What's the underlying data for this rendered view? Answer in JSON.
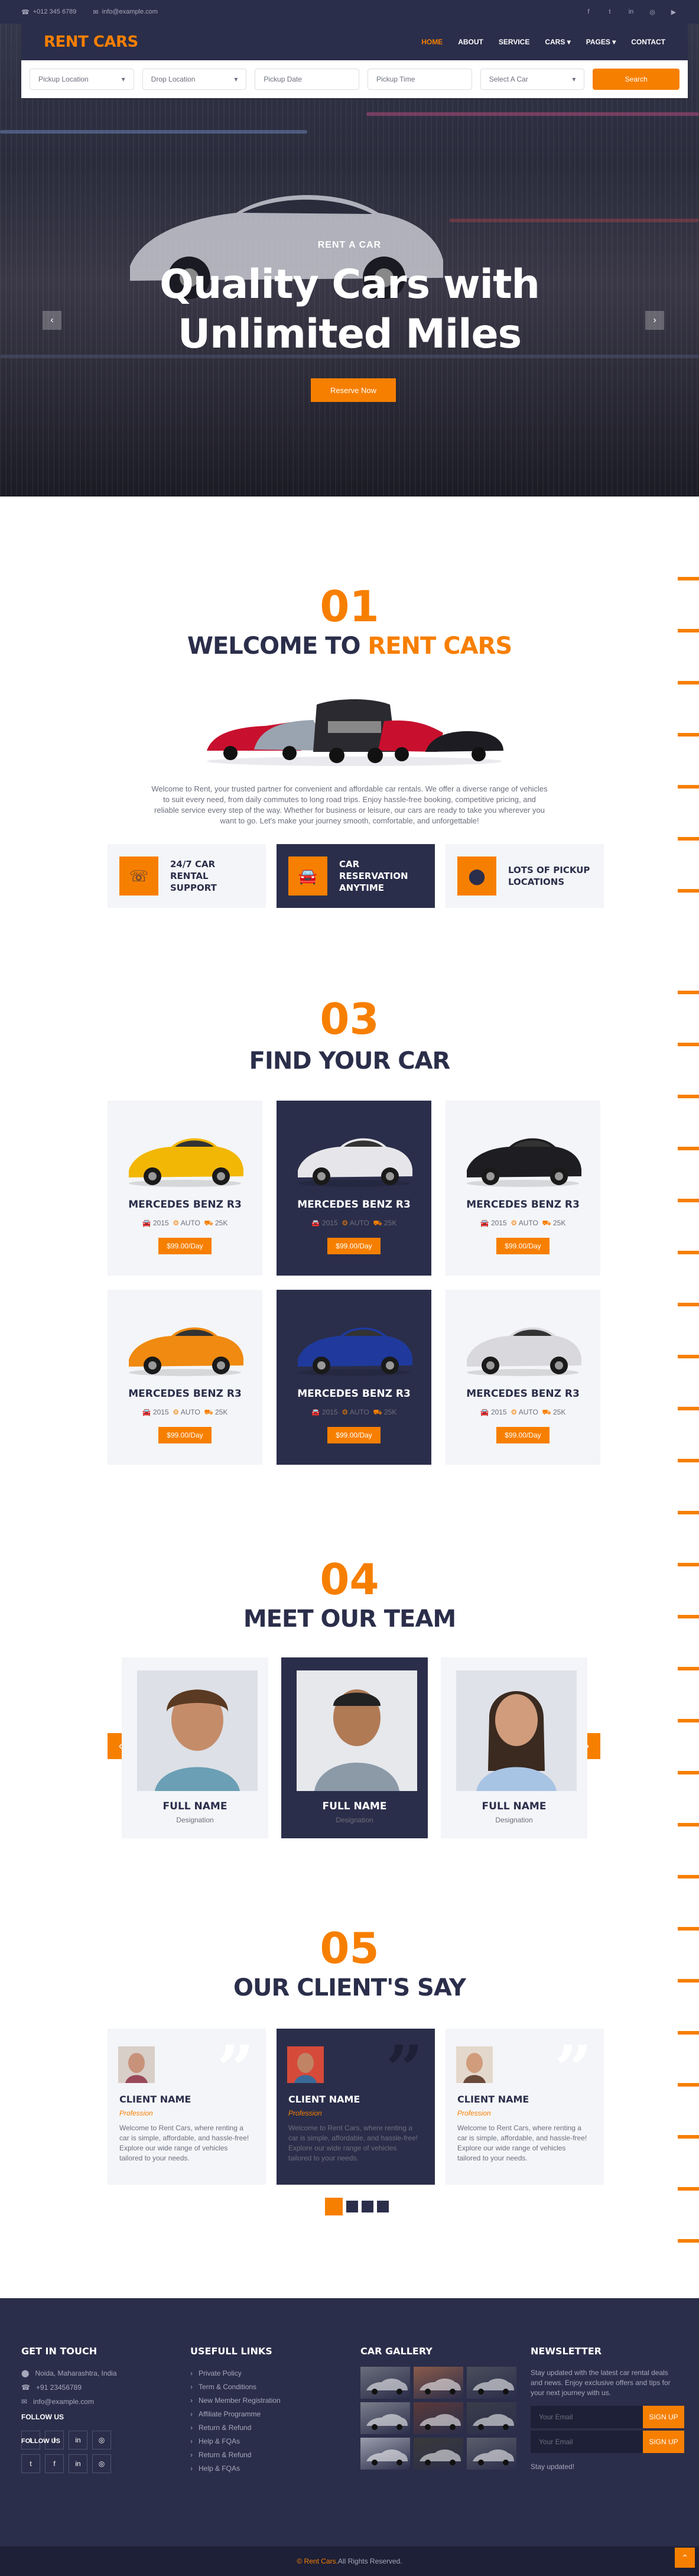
{
  "topbar": {
    "phone": "+012 345 6789",
    "email": "info@example.com"
  },
  "nav": {
    "logo": "RENT CARS",
    "items": [
      "HOME",
      "ABOUT",
      "SERVICE",
      "CARS",
      "PAGES",
      "CONTACT"
    ]
  },
  "search": {
    "fields": [
      "Pickup Location",
      "Drop Location",
      "Pickup Date",
      "Pickup Time",
      "Select A Car"
    ],
    "button": "Search"
  },
  "hero": {
    "subtitle": "RENT A CAR",
    "title_line1": "Quality Cars with",
    "title_line2": "Unlimited Miles",
    "button": "Reserve Now"
  },
  "welcome": {
    "number": "01",
    "title_a": "WELCOME TO",
    "title_b": "RENT CARS",
    "text": "Welcome to Rent, your trusted partner for convenient and affordable car rentals. We offer a diverse range of vehicles to suit every need, from daily commutes to long road trips. Enjoy hassle-free booking, competitive pricing, and reliable service every step of the way. Whether for business or leisure, our cars are ready to take you wherever you want to go. Let's make your journey smooth, comfortable, and unforgettable!",
    "features": [
      "24/7 CAR RENTAL SUPPORT",
      "CAR RESERVATION ANYTIME",
      "LOTS OF PICKUP LOCATIONS"
    ]
  },
  "cars": {
    "number": "03",
    "title": "FIND YOUR CAR",
    "items": [
      {
        "name": "MERCEDES BENZ R3",
        "year": "2015",
        "trans": "AUTO",
        "km": "25K",
        "price": "$99.00/Day",
        "color": "#f2b705"
      },
      {
        "name": "MERCEDES BENZ R3",
        "year": "2015",
        "trans": "AUTO",
        "km": "25K",
        "price": "$99.00/Day",
        "color": "#e6e6ea"
      },
      {
        "name": "MERCEDES BENZ R3",
        "year": "2015",
        "trans": "AUTO",
        "km": "25K",
        "price": "$99.00/Day",
        "color": "#1e1e22"
      },
      {
        "name": "MERCEDES BENZ R3",
        "year": "2015",
        "trans": "AUTO",
        "km": "25K",
        "price": "$99.00/Day",
        "color": "#f08a10"
      },
      {
        "name": "MERCEDES BENZ R3",
        "year": "2015",
        "trans": "AUTO",
        "km": "25K",
        "price": "$99.00/Day",
        "color": "#1f3a9c"
      },
      {
        "name": "MERCEDES BENZ R3",
        "year": "2015",
        "trans": "AUTO",
        "km": "25K",
        "price": "$99.00/Day",
        "color": "#d9d9dd"
      }
    ]
  },
  "team": {
    "number": "04",
    "title": "MEET OUR TEAM",
    "members": [
      {
        "name": "FULL NAME",
        "role": "Designation"
      },
      {
        "name": "FULL NAME",
        "role": "Designation"
      },
      {
        "name": "FULL NAME",
        "role": "Designation"
      }
    ]
  },
  "clients": {
    "number": "05",
    "title": "OUR CLIENT'S SAY",
    "items": [
      {
        "name": "CLIENT NAME",
        "role": "Profession",
        "text": "Welcome to Rent Cars, where renting a car is simple, affordable, and hassle-free! Explore our wide range of vehicles tailored to your needs."
      },
      {
        "name": "CLIENT NAME",
        "role": "Profession",
        "text": "Welcome to Rent Cars, where renting a car is simple, affordable, and hassle-free! Explore our wide range of vehicles tailored to your needs."
      },
      {
        "name": "CLIENT NAME",
        "role": "Profession",
        "text": "Welcome to Rent Cars, where renting a car is simple, affordable, and hassle-free! Explore our wide range of vehicles tailored to your needs."
      }
    ]
  },
  "footer": {
    "touch": {
      "title": "GET IN TOUCH",
      "address": "Noida, Maharashtra, India",
      "phone": "+91 23456789",
      "email": "info@example.com",
      "follow": "FOLLOW US",
      "follow2": "FOLLOW US"
    },
    "links": {
      "title": "USEFULL LINKS",
      "items": [
        "Private Policy",
        "Term & Conditions",
        "New Member Registration",
        "Affiliate Programme",
        "Return & Refund",
        "Help & FQAs",
        "Return & Refund",
        "Help & FQAs"
      ]
    },
    "gallery": {
      "title": "CAR GALLERY"
    },
    "newsletter": {
      "title": "NEWSLETTER",
      "text": "Stay updated with the latest car rental deals and news. Enjoy exclusive offers and tips for your next journey with us.",
      "placeholder": "Your Email",
      "button": "SIGN UP",
      "placeholder2": "Your Email",
      "button2": "SIGN UP",
      "updated": "Stay updated!"
    },
    "copyright_brand": "© Rent Cars.",
    "copyright_rest": " All Rights Reserved."
  }
}
